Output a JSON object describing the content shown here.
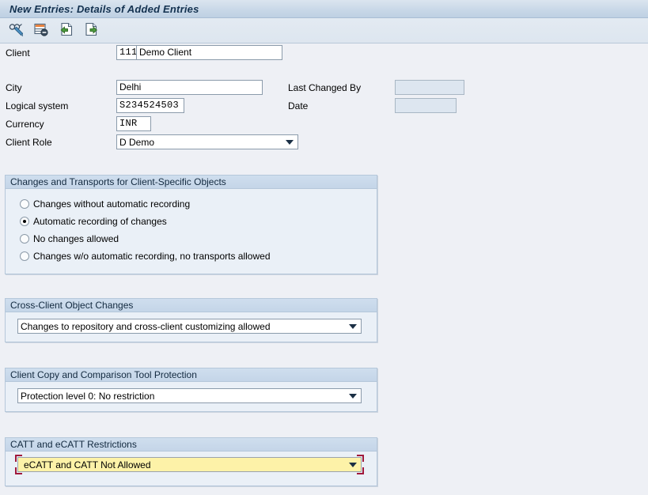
{
  "window": {
    "title": "New Entries: Details of Added Entries"
  },
  "toolbar": {
    "buttons": [
      {
        "name": "display-change-icon",
        "tooltip": "Display/Change"
      },
      {
        "name": "delete-row-icon",
        "tooltip": "Delete Row"
      },
      {
        "name": "previous-entry-icon",
        "tooltip": "Previous Entry"
      },
      {
        "name": "next-entry-icon",
        "tooltip": "Next Entry"
      }
    ]
  },
  "form": {
    "client": {
      "label": "Client",
      "number": "111",
      "name": "Demo Client"
    },
    "city": {
      "label": "City",
      "value": "Delhi"
    },
    "logical_system": {
      "label": "Logical system",
      "value": "S234524503"
    },
    "currency": {
      "label": "Currency",
      "value": "INR"
    },
    "client_role": {
      "label": "Client Role",
      "value": "D Demo"
    },
    "last_changed_by": {
      "label": "Last Changed By",
      "value": ""
    },
    "date": {
      "label": "Date",
      "value": ""
    }
  },
  "groups": {
    "changes_transports": {
      "title": "Changes and Transports for Client-Specific Objects",
      "options": [
        {
          "label": "Changes without automatic recording",
          "selected": false
        },
        {
          "label": "Automatic recording of changes",
          "selected": true
        },
        {
          "label": "No changes allowed",
          "selected": false
        },
        {
          "label": "Changes w/o automatic recording, no transports allowed",
          "selected": false
        }
      ]
    },
    "cross_client": {
      "title": "Cross-Client Object Changes",
      "value": "Changes to repository and cross-client customizing allowed"
    },
    "client_copy": {
      "title": "Client Copy and Comparison Tool Protection",
      "value": "Protection level 0: No restriction"
    },
    "catt": {
      "title": "CATT and eCATT Restrictions",
      "value": "eCATT and CATT Not Allowed",
      "focused": true
    }
  },
  "colors": {
    "title_text": "#13314f",
    "group_header": "#c4d5e8",
    "focus_background": "#fdf2a8",
    "focus_bracket": "#a01a3c",
    "readonly_field": "#dde6f0"
  }
}
